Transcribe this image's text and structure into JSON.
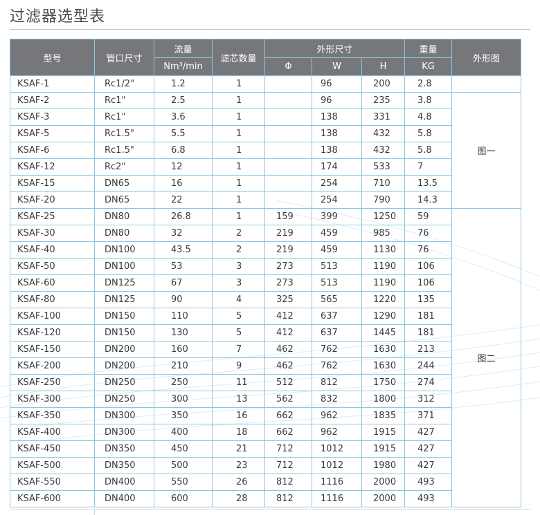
{
  "title": "过滤器选型表",
  "headers": {
    "model": "型号",
    "port": "管口尺寸",
    "flow": "流量",
    "flow_unit": "Nm³/min",
    "count": "滤芯数量",
    "dims": "外形尺寸",
    "phi": "Φ",
    "w": "W",
    "h": "H",
    "weight": "重量",
    "weight_unit": "KG",
    "figure": "外形图"
  },
  "figures": {
    "fig1": "图一",
    "fig2": "图二"
  },
  "rows": [
    {
      "model": "KSAF-1",
      "port": "Rc1/2\"",
      "flow": "1.2",
      "count": "1",
      "phi": "",
      "w": "96",
      "h": "200",
      "kg": "2.8"
    },
    {
      "model": "KSAF-2",
      "port": "Rc1\"",
      "flow": "2.5",
      "count": "1",
      "phi": "",
      "w": "96",
      "h": "235",
      "kg": "3.8"
    },
    {
      "model": "KSAF-3",
      "port": "Rc1\"",
      "flow": "3.6",
      "count": "1",
      "phi": "",
      "w": "138",
      "h": "331",
      "kg": "4.8"
    },
    {
      "model": "KSAF-5",
      "port": "Rc1.5\"",
      "flow": "5.5",
      "count": "1",
      "phi": "",
      "w": "138",
      "h": "432",
      "kg": "5.8"
    },
    {
      "model": "KSAF-6",
      "port": "Rc1.5\"",
      "flow": "6.8",
      "count": "1",
      "phi": "",
      "w": "138",
      "h": "432",
      "kg": "5.8"
    },
    {
      "model": "KSAF-12",
      "port": "Rc2\"",
      "flow": "12",
      "count": "1",
      "phi": "",
      "w": "174",
      "h": "533",
      "kg": "7"
    },
    {
      "model": "KSAF-15",
      "port": "DN65",
      "flow": "16",
      "count": "1",
      "phi": "",
      "w": "254",
      "h": "710",
      "kg": "13.5"
    },
    {
      "model": "KSAF-20",
      "port": "DN65",
      "flow": "22",
      "count": "1",
      "phi": "",
      "w": "254",
      "h": "790",
      "kg": "14.3"
    },
    {
      "model": "KSAF-25",
      "port": "DN80",
      "flow": "26.8",
      "count": "1",
      "phi": "159",
      "w": "399",
      "h": "1250",
      "kg": "59"
    },
    {
      "model": "KSAF-30",
      "port": "DN80",
      "flow": "32",
      "count": "2",
      "phi": "219",
      "w": "459",
      "h": "985",
      "kg": "76"
    },
    {
      "model": "KSAF-40",
      "port": "DN100",
      "flow": "43.5",
      "count": "2",
      "phi": "219",
      "w": "459",
      "h": "1130",
      "kg": "76"
    },
    {
      "model": "KSAF-50",
      "port": "DN100",
      "flow": "53",
      "count": "3",
      "phi": "273",
      "w": "513",
      "h": "1190",
      "kg": "106"
    },
    {
      "model": "KSAF-60",
      "port": "DN125",
      "flow": "67",
      "count": "3",
      "phi": "273",
      "w": "513",
      "h": "1190",
      "kg": "106"
    },
    {
      "model": "KSAF-80",
      "port": "DN125",
      "flow": "90",
      "count": "4",
      "phi": "325",
      "w": "565",
      "h": "1220",
      "kg": "135"
    },
    {
      "model": "KSAF-100",
      "port": "DN150",
      "flow": "110",
      "count": "5",
      "phi": "412",
      "w": "637",
      "h": "1290",
      "kg": "181"
    },
    {
      "model": "KSAF-120",
      "port": "DN150",
      "flow": "130",
      "count": "5",
      "phi": "412",
      "w": "637",
      "h": "1445",
      "kg": "181"
    },
    {
      "model": "KSAF-150",
      "port": "DN200",
      "flow": "160",
      "count": "7",
      "phi": "462",
      "w": "762",
      "h": "1630",
      "kg": "213"
    },
    {
      "model": "KSAF-200",
      "port": "DN200",
      "flow": "210",
      "count": "9",
      "phi": "462",
      "w": "762",
      "h": "1630",
      "kg": "244"
    },
    {
      "model": "KSAF-250",
      "port": "DN250",
      "flow": "250",
      "count": "11",
      "phi": "512",
      "w": "812",
      "h": "1750",
      "kg": "274"
    },
    {
      "model": "KSAF-300",
      "port": "DN250",
      "flow": "300",
      "count": "13",
      "phi": "562",
      "w": "832",
      "h": "1800",
      "kg": "312"
    },
    {
      "model": "KSAF-350",
      "port": "DN300",
      "flow": "350",
      "count": "16",
      "phi": "662",
      "w": "962",
      "h": "1835",
      "kg": "371"
    },
    {
      "model": "KSAF-400",
      "port": "DN300",
      "flow": "400",
      "count": "18",
      "phi": "662",
      "w": "962",
      "h": "1915",
      "kg": "427"
    },
    {
      "model": "KSAF-450",
      "port": "DN350",
      "flow": "450",
      "count": "21",
      "phi": "712",
      "w": "1012",
      "h": "1915",
      "kg": "427"
    },
    {
      "model": "KSAF-500",
      "port": "DN350",
      "flow": "500",
      "count": "23",
      "phi": "712",
      "w": "1012",
      "h": "1980",
      "kg": "427"
    },
    {
      "model": "KSAF-550",
      "port": "DN400",
      "flow": "550",
      "count": "26",
      "phi": "812",
      "w": "1116",
      "h": "2000",
      "kg": "493"
    },
    {
      "model": "KSAF-600",
      "port": "DN400",
      "flow": "600",
      "count": "28",
      "phi": "812",
      "w": "1116",
      "h": "2000",
      "kg": "493"
    }
  ],
  "colors": {
    "header_bg": "#76777a",
    "header_text": "#ffffff",
    "grid_line": "#8cc6e3",
    "body_text": "#3a3a3a"
  }
}
